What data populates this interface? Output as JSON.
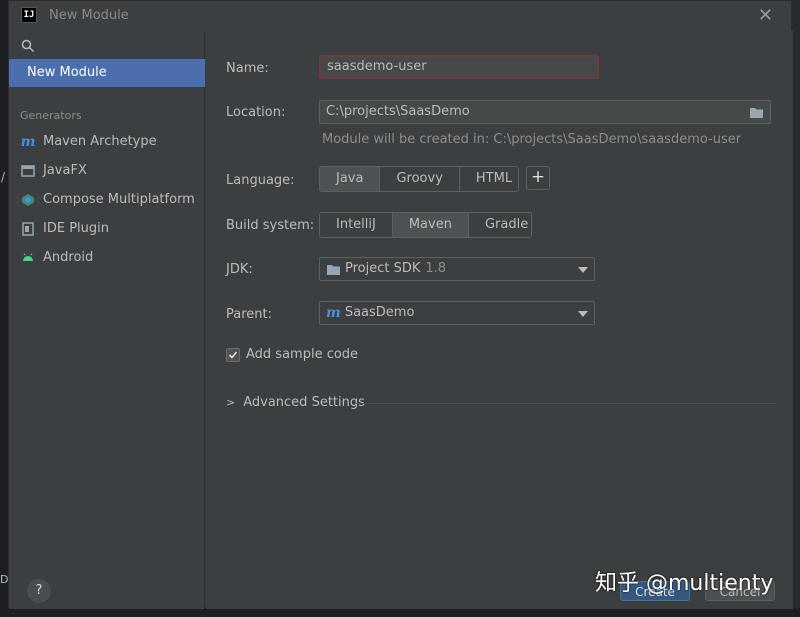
{
  "window": {
    "title": "New Module",
    "app_icon_text": "IJ"
  },
  "sidebar": {
    "selected_label": "New Module",
    "generators_header": "Generators",
    "items": [
      {
        "label": "Maven Archetype",
        "icon": "maven-icon"
      },
      {
        "label": "JavaFX",
        "icon": "javafx-icon"
      },
      {
        "label": "Compose Multiplatform",
        "icon": "compose-icon"
      },
      {
        "label": "IDE Plugin",
        "icon": "ide-plugin-icon"
      },
      {
        "label": "Android",
        "icon": "android-icon"
      }
    ],
    "help_label": "?"
  },
  "form": {
    "name_label": "Name:",
    "name_value": "saasdemo-user",
    "location_label": "Location:",
    "location_value": "C:\\projects\\SaasDemo",
    "location_hint": "Module will be created in: C:\\projects\\SaasDemo\\saasdemo-user",
    "language_label": "Language:",
    "languages": [
      "Java",
      "Groovy",
      "HTML"
    ],
    "language_selected": "Java",
    "build_label": "Build system:",
    "build_systems": [
      "IntelliJ",
      "Maven",
      "Gradle"
    ],
    "build_selected": "Maven",
    "jdk_label": "JDK:",
    "jdk_value": "Project SDK",
    "jdk_version": "1.8",
    "parent_label": "Parent:",
    "parent_value": "SaasDemo",
    "sample_code_label": "Add sample code",
    "sample_code_checked": true,
    "advanced_label": "Advanced Settings"
  },
  "buttons": {
    "create": "Create",
    "cancel": "Cancel"
  },
  "watermark": "知乎 @multienty",
  "colors": {
    "accent": "#4b6eaf",
    "error_border": "#743a3a",
    "primary_button": "#365880"
  }
}
